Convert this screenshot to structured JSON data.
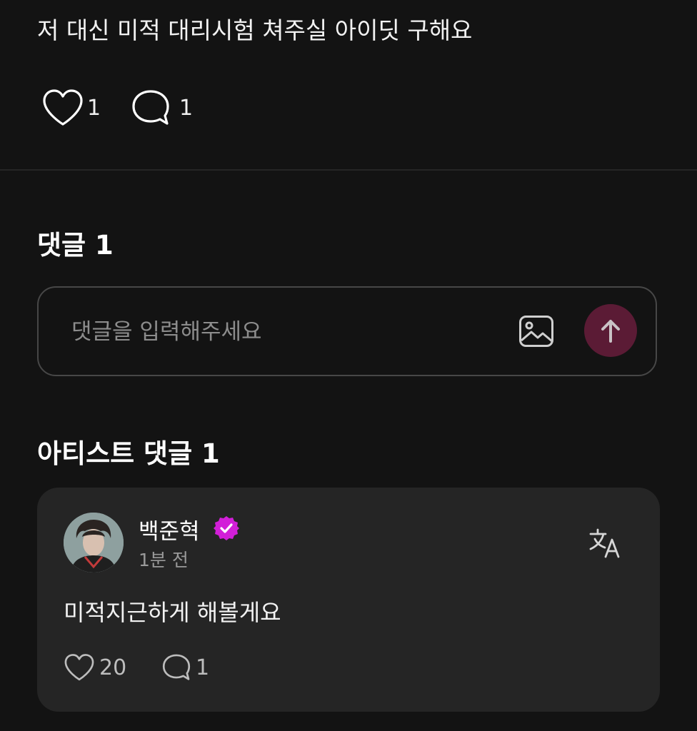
{
  "post": {
    "text": "저 대신 미적 대리시험 쳐주실 아이딧 구해요",
    "likes": "1",
    "comments": "1"
  },
  "comments_section": {
    "title": "댓글 1",
    "input_placeholder": "댓글을 입력해주세요",
    "send_color": "#5b1b35"
  },
  "artist_comments": {
    "title": "아티스트 댓글 1",
    "items": [
      {
        "author": "백준혁",
        "time": "1분 전",
        "text": "미적지근하게 해볼게요",
        "likes": "20",
        "replies": "1",
        "verified_color": "#d21fd8"
      }
    ]
  }
}
